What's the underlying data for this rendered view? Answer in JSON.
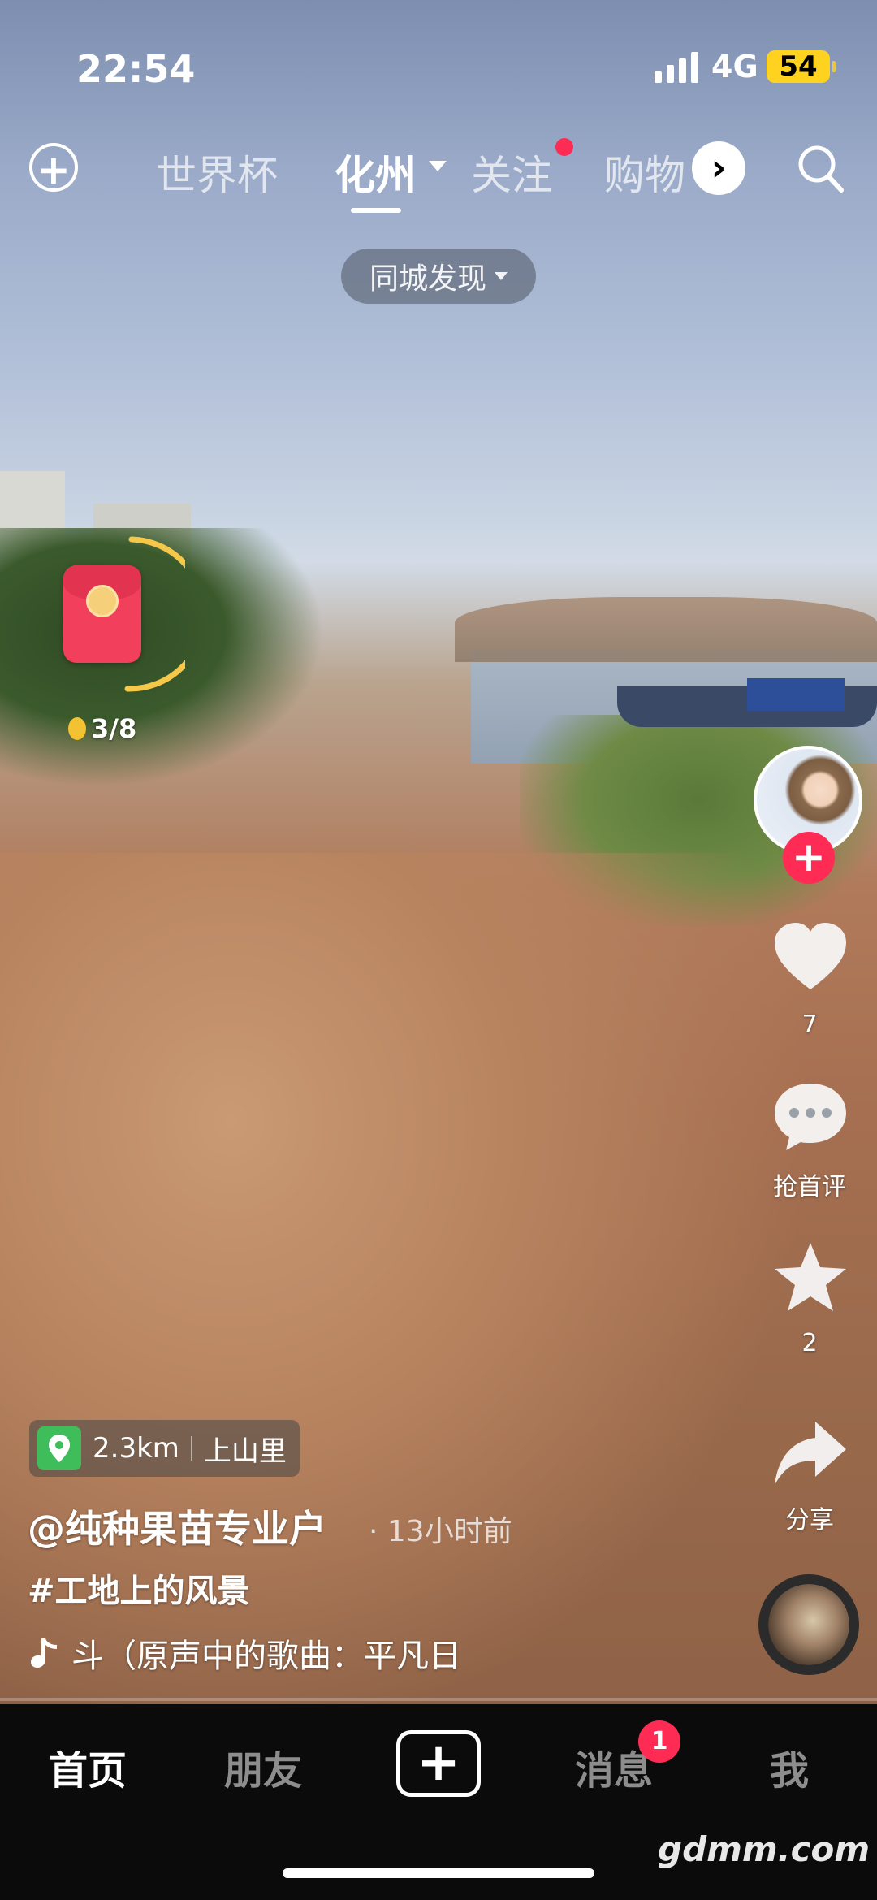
{
  "status_bar": {
    "time": "22:54",
    "network": "4G",
    "battery": "54"
  },
  "top_nav": {
    "tabs": [
      "世界杯",
      "化州",
      "关注",
      "购物"
    ],
    "active_tab": "化州"
  },
  "city_filter": {
    "label": "同城发现"
  },
  "red_packet": {
    "progress_text": "3/8",
    "ring_progress": 0.375
  },
  "creator": {
    "likes": "7",
    "comment_label": "抢首评",
    "favorites": "2",
    "share_label": "分享"
  },
  "video_info": {
    "distance": "2.3km",
    "place": "上山里",
    "author": "@纯种果苗专业户",
    "time_ago": "13小时前",
    "hashtag": "#工地上的风景",
    "music": "斗（原声中的歌曲：平凡日"
  },
  "bottom_nav": {
    "items": [
      "首页",
      "朋友",
      "消息",
      "我"
    ],
    "active": "首页",
    "message_badge": "1"
  },
  "watermark": "gdmm.com",
  "colors": {
    "accent": "#fe2c55",
    "location_pin": "#3fbd5a",
    "battery": "#ffd21f"
  }
}
